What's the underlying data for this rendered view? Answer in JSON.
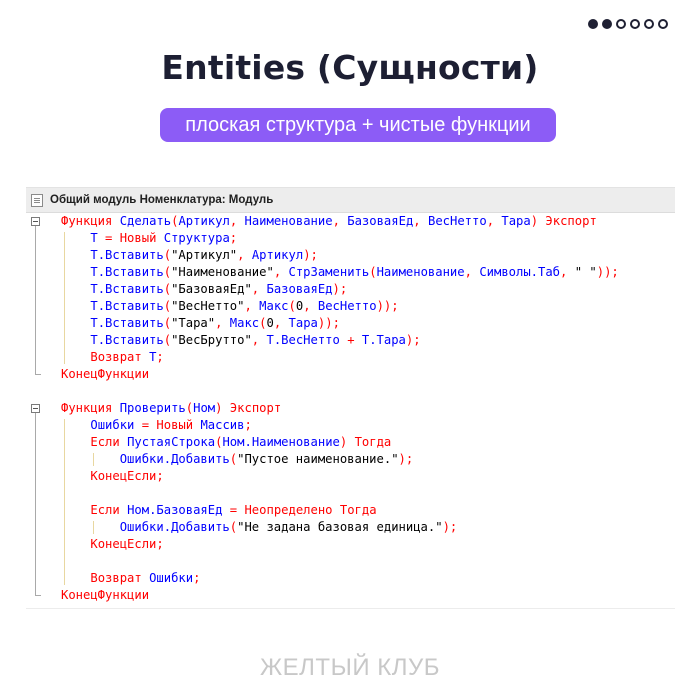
{
  "pager": {
    "total": 6,
    "active": 2
  },
  "title": "Entities (Сущности)",
  "subtitle": "плоская структура + чистые функции",
  "editor": {
    "header_title": "Общий модуль Номенклатура: Модуль",
    "lines": [
      [
        {
          "t": "Функция",
          "c": "kw"
        },
        {
          "t": " "
        },
        {
          "t": "Сделать",
          "c": "id"
        },
        {
          "t": "(",
          "c": "op"
        },
        {
          "t": "Артикул",
          "c": "id"
        },
        {
          "t": ", ",
          "c": "op"
        },
        {
          "t": "Наименование",
          "c": "id"
        },
        {
          "t": ", ",
          "c": "op"
        },
        {
          "t": "БазоваяЕд",
          "c": "id"
        },
        {
          "t": ", ",
          "c": "op"
        },
        {
          "t": "ВесНетто",
          "c": "id"
        },
        {
          "t": ", ",
          "c": "op"
        },
        {
          "t": "Тара",
          "c": "id"
        },
        {
          "t": ")",
          "c": "op"
        },
        {
          "t": " "
        },
        {
          "t": "Экспорт",
          "c": "kw"
        }
      ],
      [
        {
          "t": "    "
        },
        {
          "t": "Т",
          "c": "id"
        },
        {
          "t": " = ",
          "c": "op"
        },
        {
          "t": "Новый",
          "c": "kw"
        },
        {
          "t": " "
        },
        {
          "t": "Структура",
          "c": "id"
        },
        {
          "t": ";",
          "c": "op"
        }
      ],
      [
        {
          "t": "    "
        },
        {
          "t": "Т.Вставить",
          "c": "id"
        },
        {
          "t": "(",
          "c": "op"
        },
        {
          "t": "\"Артикул\"",
          "c": "str"
        },
        {
          "t": ", ",
          "c": "op"
        },
        {
          "t": "Артикул",
          "c": "id"
        },
        {
          "t": ");",
          "c": "op"
        }
      ],
      [
        {
          "t": "    "
        },
        {
          "t": "Т.Вставить",
          "c": "id"
        },
        {
          "t": "(",
          "c": "op"
        },
        {
          "t": "\"Наименование\"",
          "c": "str"
        },
        {
          "t": ", ",
          "c": "op"
        },
        {
          "t": "СтрЗаменить",
          "c": "id"
        },
        {
          "t": "(",
          "c": "op"
        },
        {
          "t": "Наименование",
          "c": "id"
        },
        {
          "t": ", ",
          "c": "op"
        },
        {
          "t": "Символы.Таб",
          "c": "id"
        },
        {
          "t": ", ",
          "c": "op"
        },
        {
          "t": "\" \"",
          "c": "str"
        },
        {
          "t": "));",
          "c": "op"
        }
      ],
      [
        {
          "t": "    "
        },
        {
          "t": "Т.Вставить",
          "c": "id"
        },
        {
          "t": "(",
          "c": "op"
        },
        {
          "t": "\"БазоваяЕд\"",
          "c": "str"
        },
        {
          "t": ", ",
          "c": "op"
        },
        {
          "t": "БазоваяЕд",
          "c": "id"
        },
        {
          "t": ");",
          "c": "op"
        }
      ],
      [
        {
          "t": "    "
        },
        {
          "t": "Т.Вставить",
          "c": "id"
        },
        {
          "t": "(",
          "c": "op"
        },
        {
          "t": "\"ВесНетто\"",
          "c": "str"
        },
        {
          "t": ", ",
          "c": "op"
        },
        {
          "t": "Макс",
          "c": "id"
        },
        {
          "t": "(",
          "c": "op"
        },
        {
          "t": "0",
          "c": "num"
        },
        {
          "t": ", ",
          "c": "op"
        },
        {
          "t": "ВесНетто",
          "c": "id"
        },
        {
          "t": "));",
          "c": "op"
        }
      ],
      [
        {
          "t": "    "
        },
        {
          "t": "Т.Вставить",
          "c": "id"
        },
        {
          "t": "(",
          "c": "op"
        },
        {
          "t": "\"Тара\"",
          "c": "str"
        },
        {
          "t": ", ",
          "c": "op"
        },
        {
          "t": "Макс",
          "c": "id"
        },
        {
          "t": "(",
          "c": "op"
        },
        {
          "t": "0",
          "c": "num"
        },
        {
          "t": ", ",
          "c": "op"
        },
        {
          "t": "Тара",
          "c": "id"
        },
        {
          "t": "));",
          "c": "op"
        }
      ],
      [
        {
          "t": "    "
        },
        {
          "t": "Т.Вставить",
          "c": "id"
        },
        {
          "t": "(",
          "c": "op"
        },
        {
          "t": "\"ВесБрутто\"",
          "c": "str"
        },
        {
          "t": ", ",
          "c": "op"
        },
        {
          "t": "Т.ВесНетто",
          "c": "id"
        },
        {
          "t": " + ",
          "c": "op"
        },
        {
          "t": "Т.Тара",
          "c": "id"
        },
        {
          "t": ");",
          "c": "op"
        }
      ],
      [
        {
          "t": "    "
        },
        {
          "t": "Возврат",
          "c": "kw"
        },
        {
          "t": " "
        },
        {
          "t": "Т",
          "c": "id"
        },
        {
          "t": ";",
          "c": "op"
        }
      ],
      [
        {
          "t": "КонецФункции",
          "c": "kw"
        }
      ],
      [],
      [
        {
          "t": "Функция",
          "c": "kw"
        },
        {
          "t": " "
        },
        {
          "t": "Проверить",
          "c": "id"
        },
        {
          "t": "(",
          "c": "op"
        },
        {
          "t": "Ном",
          "c": "id"
        },
        {
          "t": ")",
          "c": "op"
        },
        {
          "t": " "
        },
        {
          "t": "Экспорт",
          "c": "kw"
        }
      ],
      [
        {
          "t": "    "
        },
        {
          "t": "Ошибки",
          "c": "id"
        },
        {
          "t": " = ",
          "c": "op"
        },
        {
          "t": "Новый",
          "c": "kw"
        },
        {
          "t": " "
        },
        {
          "t": "Массив",
          "c": "id"
        },
        {
          "t": ";",
          "c": "op"
        }
      ],
      [
        {
          "t": "    "
        },
        {
          "t": "Если",
          "c": "kw"
        },
        {
          "t": " "
        },
        {
          "t": "ПустаяСтрока",
          "c": "id"
        },
        {
          "t": "(",
          "c": "op"
        },
        {
          "t": "Ном.Наименование",
          "c": "id"
        },
        {
          "t": ")",
          "c": "op"
        },
        {
          "t": " "
        },
        {
          "t": "Тогда",
          "c": "kw"
        }
      ],
      [
        {
          "t": "        "
        },
        {
          "t": "Ошибки.Добавить",
          "c": "id"
        },
        {
          "t": "(",
          "c": "op"
        },
        {
          "t": "\"Пустое наименование.\"",
          "c": "str"
        },
        {
          "t": ");",
          "c": "op"
        }
      ],
      [
        {
          "t": "    "
        },
        {
          "t": "КонецЕсли",
          "c": "kw"
        },
        {
          "t": ";",
          "c": "op"
        }
      ],
      [],
      [
        {
          "t": "    "
        },
        {
          "t": "Если",
          "c": "kw"
        },
        {
          "t": " "
        },
        {
          "t": "Ном.БазоваяЕд",
          "c": "id"
        },
        {
          "t": " = ",
          "c": "op"
        },
        {
          "t": "Неопределено",
          "c": "kw"
        },
        {
          "t": " "
        },
        {
          "t": "Тогда",
          "c": "kw"
        }
      ],
      [
        {
          "t": "        "
        },
        {
          "t": "Ошибки.Добавить",
          "c": "id"
        },
        {
          "t": "(",
          "c": "op"
        },
        {
          "t": "\"Не задана базовая единица.\"",
          "c": "str"
        },
        {
          "t": ");",
          "c": "op"
        }
      ],
      [
        {
          "t": "    "
        },
        {
          "t": "КонецЕсли",
          "c": "kw"
        },
        {
          "t": ";",
          "c": "op"
        }
      ],
      [],
      [
        {
          "t": "    "
        },
        {
          "t": "Возврат",
          "c": "kw"
        },
        {
          "t": " "
        },
        {
          "t": "Ошибки",
          "c": "id"
        },
        {
          "t": ";",
          "c": "op"
        }
      ],
      [
        {
          "t": "КонецФункции",
          "c": "kw"
        }
      ]
    ]
  },
  "footer": "ЖЕЛТЫЙ КЛУБ"
}
